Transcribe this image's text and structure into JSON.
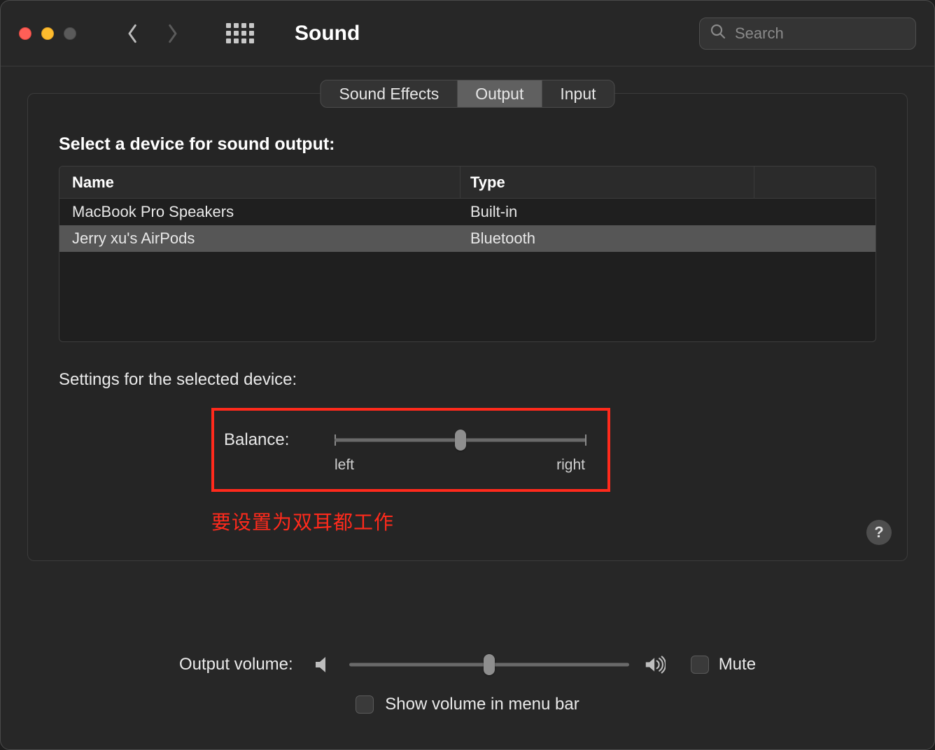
{
  "window": {
    "title": "Sound"
  },
  "search": {
    "placeholder": "Search"
  },
  "tabs": {
    "items": [
      {
        "label": "Sound Effects",
        "active": false
      },
      {
        "label": "Output",
        "active": true
      },
      {
        "label": "Input",
        "active": false
      }
    ]
  },
  "output": {
    "select_label": "Select a device for sound output:",
    "columns": {
      "name": "Name",
      "type": "Type"
    },
    "devices": [
      {
        "name": "MacBook Pro Speakers",
        "type": "Built-in",
        "selected": false
      },
      {
        "name": "Jerry xu's AirPods",
        "type": "Bluetooth",
        "selected": true
      }
    ],
    "settings_label": "Settings for the selected device:",
    "balance": {
      "label": "Balance:",
      "left_label": "left",
      "right_label": "right",
      "value": 0.5
    }
  },
  "annotation": {
    "text": "要设置为双耳都工作"
  },
  "help_glyph": "?",
  "volume": {
    "label": "Output volume:",
    "value": 0.5,
    "mute_label": "Mute",
    "mute_checked": false
  },
  "menu_bar": {
    "label": "Show volume in menu bar",
    "checked": false
  }
}
